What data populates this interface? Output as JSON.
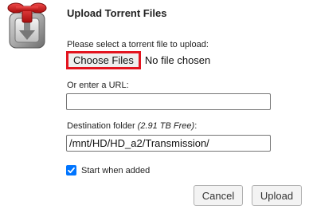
{
  "dialog": {
    "title": "Upload Torrent Files"
  },
  "file_picker": {
    "prompt": "Please select a torrent file to upload:",
    "button_label": "Choose Files",
    "status": "No file chosen"
  },
  "url_field": {
    "label": "Or enter a URL:",
    "value": ""
  },
  "destination": {
    "label": "Destination folder",
    "free_space": "(2.91 TB Free)",
    "label_suffix": ":",
    "value": "/mnt/HD/HD_a2/Transmission/"
  },
  "start_when_added": {
    "label": "Start when added",
    "checked": true
  },
  "actions": {
    "cancel_label": "Cancel",
    "upload_label": "Upload"
  },
  "icons": {
    "app": "transmission-icon",
    "checkbox": "check-icon"
  },
  "colors": {
    "highlight_border": "#e3141f",
    "checkbox_accent": "#0075ff"
  }
}
